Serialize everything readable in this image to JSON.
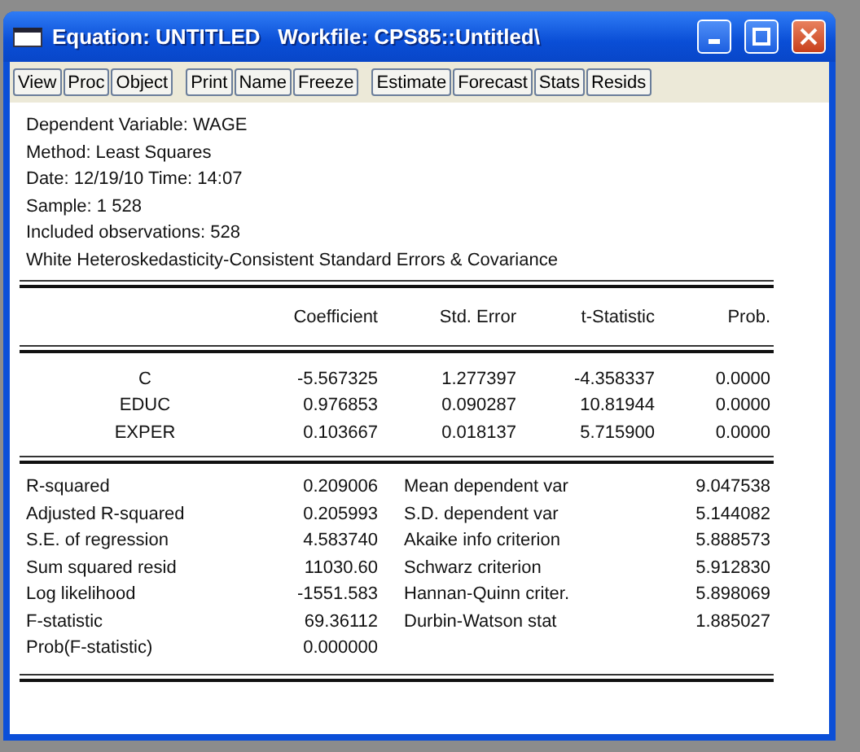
{
  "window": {
    "title": "Equation: UNTITLED   Workfile: CPS85::Untitled\\"
  },
  "toolbar_groups": [
    [
      "View",
      "Proc",
      "Object"
    ],
    [
      "Print",
      "Name",
      "Freeze"
    ],
    [
      "Estimate",
      "Forecast",
      "Stats",
      "Resids"
    ]
  ],
  "header_lines": [
    "Dependent Variable: WAGE",
    "Method: Least Squares",
    "Date: 12/19/10   Time: 14:07",
    "Sample: 1 528",
    "Included observations: 528",
    "White Heteroskedasticity-Consistent Standard Errors & Covariance"
  ],
  "coefficients": {
    "columns": [
      "Coefficient",
      "Std. Error",
      "t-Statistic",
      "Prob."
    ],
    "rows": [
      {
        "variable": "C",
        "values": [
          "-5.567325",
          "1.277397",
          "-4.358337",
          "0.0000"
        ]
      },
      {
        "variable": "EDUC",
        "values": [
          "0.976853",
          "0.090287",
          "10.81944",
          "0.0000"
        ]
      },
      {
        "variable": "EXPER",
        "values": [
          "0.103667",
          "0.018137",
          "5.715900",
          "0.0000"
        ]
      }
    ]
  },
  "statistics": [
    {
      "label": "R-squared",
      "value": "0.209006",
      "label_2": "Mean dependent var",
      "value_2": "9.047538"
    },
    {
      "label": "Adjusted R-squared",
      "value": "0.205993",
      "label_2": "S.D. dependent var",
      "value_2": "5.144082"
    },
    {
      "label": "S.E. of regression",
      "value": "4.583740",
      "label_2": "Akaike info criterion",
      "value_2": "5.888573"
    },
    {
      "label": "Sum squared resid",
      "value": "11030.60",
      "label_2": "Schwarz criterion",
      "value_2": "5.912830"
    },
    {
      "label": "Log likelihood",
      "value": "-1551.583",
      "label_2": "Hannan-Quinn criter.",
      "value_2": "5.898069"
    },
    {
      "label": "F-statistic",
      "value": "69.36112",
      "label_2": "Durbin-Watson stat",
      "value_2": "1.885027"
    },
    {
      "label": "Prob(F-statistic)",
      "value": "0.000000"
    }
  ]
}
